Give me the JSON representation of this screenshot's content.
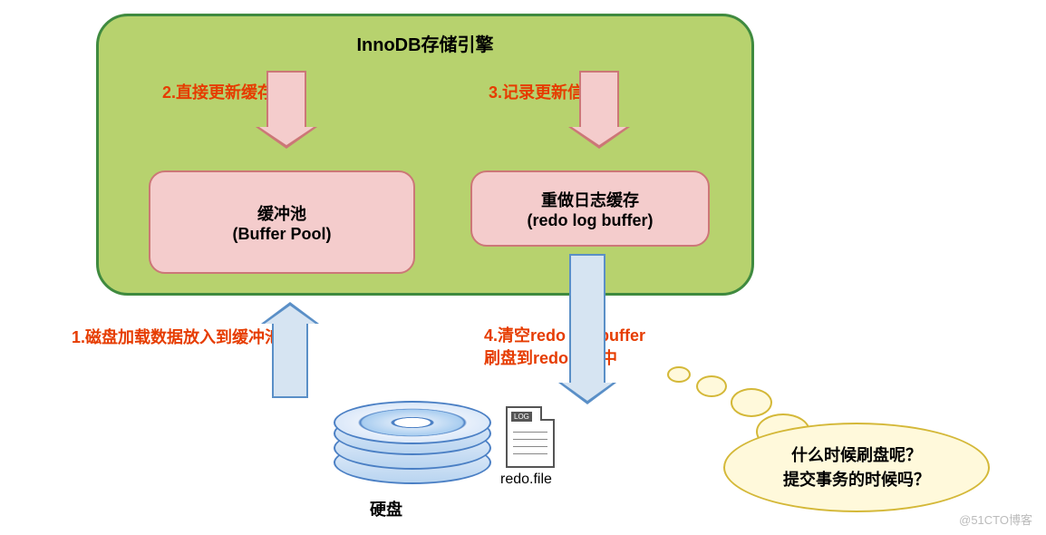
{
  "engine": {
    "title": "InnoDB存储引擎"
  },
  "boxes": {
    "buffer": {
      "line1": "缓冲池",
      "line2": "(Buffer Pool)"
    },
    "redo": {
      "line1": "重做日志缓存",
      "line2": "(redo log buffer)"
    }
  },
  "steps": {
    "s1": "1.磁盘加载数据放入到缓冲池",
    "s2": "2.直接更新缓存数据",
    "s3": "3.记录更新信息",
    "s4a": "4.清空redo log buffer",
    "s4b": "刷盘到redo日志中"
  },
  "disk": {
    "label": "硬盘",
    "file_tag": "LOG",
    "file_label": "redo.file"
  },
  "bubble": {
    "line1": "什么时候刷盘呢？",
    "line2": "提交事务的时候吗？"
  },
  "watermark": "@51CTO博客"
}
